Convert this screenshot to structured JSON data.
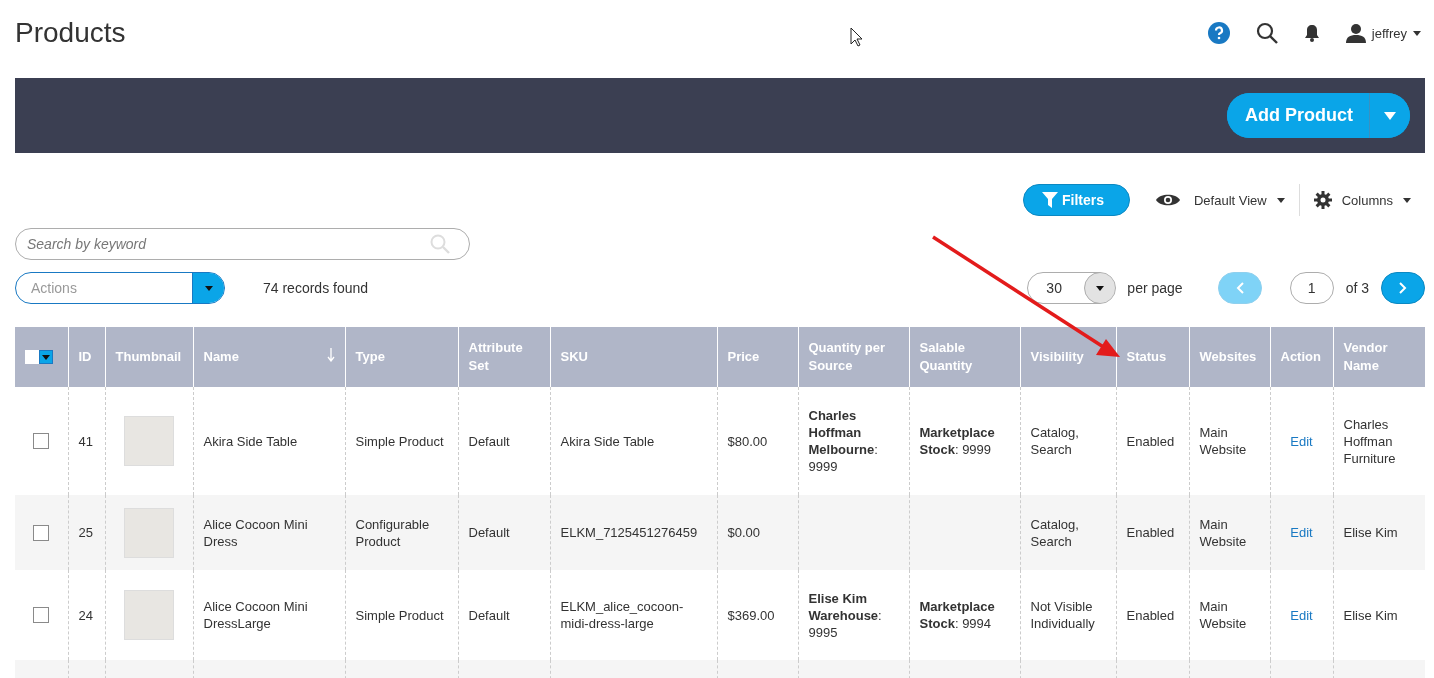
{
  "page_title": "Products",
  "user": {
    "name": "jeffrey"
  },
  "add_button": {
    "label": "Add Product"
  },
  "toolbar": {
    "filters": "Filters",
    "view": "Default View",
    "columns": "Columns"
  },
  "search": {
    "placeholder": "Search by keyword"
  },
  "actions": {
    "placeholder": "Actions"
  },
  "records": "74 records found",
  "pagination": {
    "per_page_value": "30",
    "per_page_label": "per page",
    "page": "1",
    "of": "of 3",
    "prev_disabled": true,
    "next_disabled": false
  },
  "table": {
    "select_all": {
      "checked": false
    },
    "columns": [
      {
        "label": "ID",
        "sorted": false
      },
      {
        "label": "Thumbnail",
        "sorted": false
      },
      {
        "label": "Name",
        "sorted": true
      },
      {
        "label": "Type",
        "sorted": false
      },
      {
        "label": "Attribute Set",
        "sorted": false
      },
      {
        "label": "SKU",
        "sorted": false
      },
      {
        "label": "Price",
        "sorted": false
      },
      {
        "label": "Quantity per Source",
        "sorted": false
      },
      {
        "label": "Salable Quantity",
        "sorted": false
      },
      {
        "label": "Visibility",
        "sorted": false
      },
      {
        "label": "Status",
        "sorted": false
      },
      {
        "label": "Websites",
        "sorted": false
      },
      {
        "label": "Action",
        "sorted": false
      },
      {
        "label": "Vendor Name",
        "sorted": false
      }
    ],
    "rows": [
      {
        "checked": false,
        "id": "41",
        "name": "Akira Side Table",
        "type": "Simple Product",
        "attribute_set": "Default",
        "sku": "Akira Side Table",
        "price": "$80.00",
        "quantity": "**Charles Hoffman Melbourne**: 9999",
        "salable": "**Marketplace Stock**: 9999",
        "visibility": "Catalog, Search",
        "status": "Enabled",
        "websites": "Main Website",
        "action": "Edit",
        "vendor": "Charles Hoffman Furniture"
      },
      {
        "checked": false,
        "id": "25",
        "name": "Alice Cocoon Mini Dress",
        "type": "Configurable Product",
        "attribute_set": "Default",
        "sku": "ELKM_7125451276459",
        "price": "$0.00",
        "visibility": "Catalog, Search",
        "status": "Enabled",
        "websites": "Main Website",
        "action": "Edit",
        "vendor": "Elise Kim"
      },
      {
        "checked": false,
        "id": "24",
        "name": "Alice Cocoon Mini DressLarge",
        "type": "Simple Product",
        "attribute_set": "Default",
        "sku": "ELKM_alice_cocoon-midi-dress-large",
        "price": "$369.00",
        "quantity": "**Elise Kim Warehouse**: 9995",
        "salable": "**Marketplace Stock**: 9994",
        "visibility": "Not Visible Individually",
        "status": "Enabled",
        "websites": "Main Website",
        "action": "Edit",
        "vendor": "Elise Kim"
      }
    ]
  }
}
